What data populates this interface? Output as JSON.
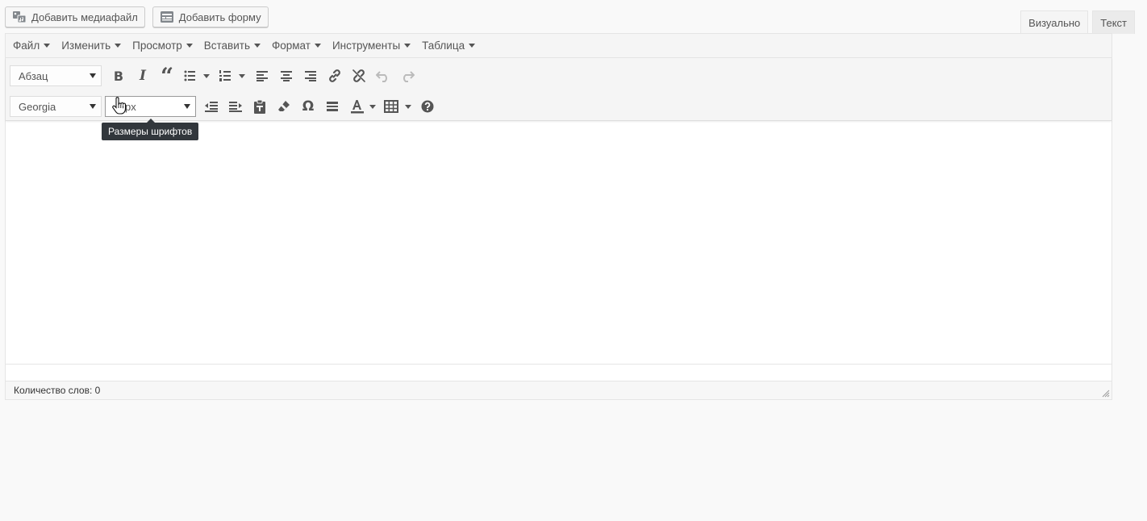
{
  "buttons": {
    "add_media": "Добавить медиафайл",
    "add_form": "Добавить форму"
  },
  "tabs": {
    "visual": "Визуально",
    "text": "Текст"
  },
  "menu": {
    "file": "Файл",
    "edit": "Изменить",
    "view": "Просмотр",
    "insert": "Вставить",
    "format": "Формат",
    "tools": "Инструменты",
    "table": "Таблица"
  },
  "toolbar": {
    "paragraph_select": "Абзац",
    "font_family_select": "Georgia",
    "font_size_select": "px"
  },
  "tooltip": "Размеры шрифтов",
  "status": {
    "word_count": "Количество слов: 0"
  },
  "icons": {
    "bold": "Β",
    "italic": "I",
    "blockquote": "“",
    "special_char": "Ω"
  }
}
